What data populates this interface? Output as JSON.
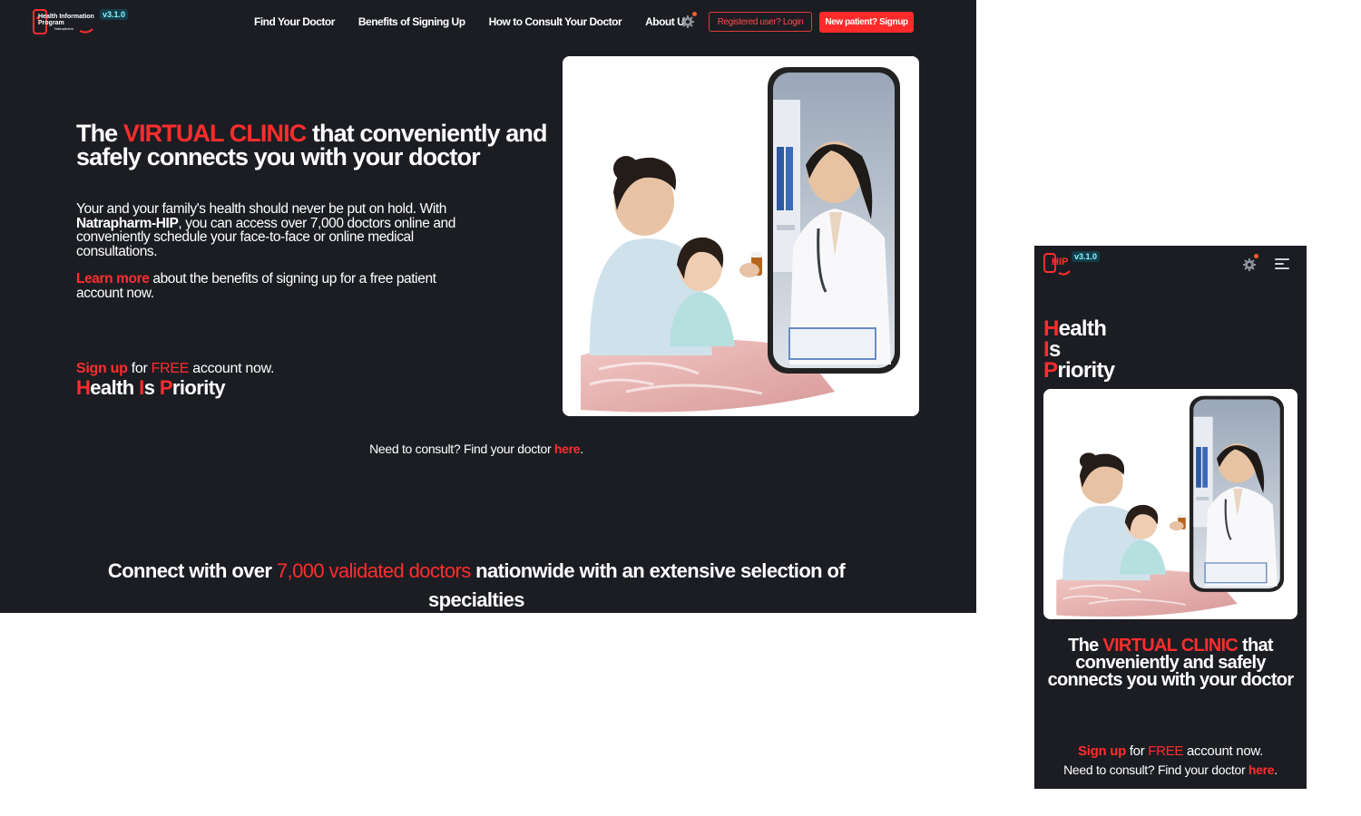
{
  "brand": {
    "logo_line1": "Health Information",
    "logo_line2": "Program",
    "logo_sub": "Natrapharm",
    "logo_short": "HIP",
    "version": "v3.1.0"
  },
  "colors": {
    "accent": "#ff2d2d",
    "background": "#1b1d23",
    "text": "#ffffff",
    "version_badge": "#8af5ff"
  },
  "icons": {
    "settings": "gear-icon",
    "menu": "hamburger-menu-icon",
    "notification": "notification-dot-icon"
  },
  "nav": {
    "items": [
      {
        "label": "Find Your Doctor"
      },
      {
        "label": "Benefits of Signing Up"
      },
      {
        "label": "How to Consult Your Doctor"
      },
      {
        "label": "About Us"
      }
    ],
    "login_label": "Registered user? Login",
    "signup_label": "New patient? Signup"
  },
  "hero": {
    "headline_the": "The",
    "headline_highlight": "VIRTUAL CLINIC",
    "headline_rest": "that conveniently and safely connects you with your doctor",
    "lead_pre": "Your and your family's health should never be put on hold. With",
    "lead_brand": "Natrapharm-HIP",
    "lead_post": ", you can access over 7,000 doctors online and conveniently schedule your face-to-face or online medical consultations.",
    "learn_more": "Learn more",
    "learn_rest": "about the benefits of signing up for a free patient account now.",
    "sign_up": "Sign up",
    "sign_for": "for",
    "sign_free": "FREE",
    "sign_rest": "account now.",
    "hip_h": "H",
    "hip_ealth": "ealth",
    "hip_i": "I",
    "hip_s": "s",
    "hip_p": "P",
    "hip_riority": "riority",
    "image_alt": "Doctor consulting a mother and child through a smartphone"
  },
  "consult": {
    "text": "Need to consult? Find your doctor",
    "link": "here",
    "period": "."
  },
  "connect": {
    "pre": "Connect with over",
    "highlight": "7,000 validated doctors",
    "post": "nationwide with an extensive selection of specialties"
  }
}
